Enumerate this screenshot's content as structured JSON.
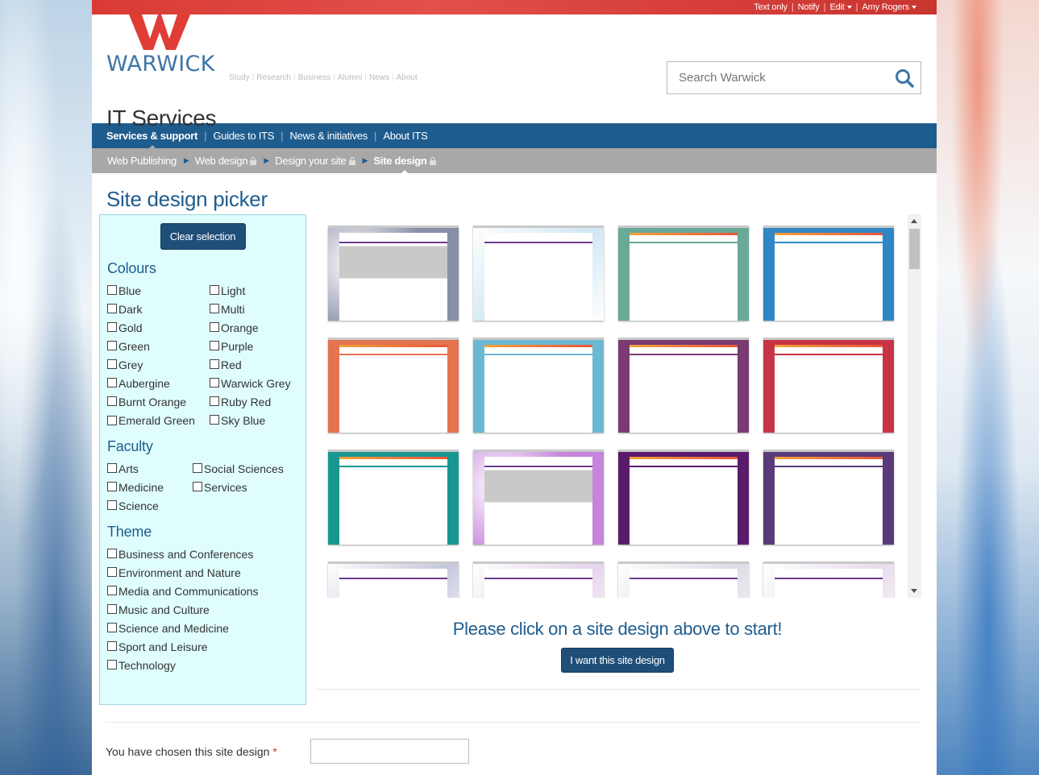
{
  "utility": {
    "text_only": "Text only",
    "notify": "Notify",
    "edit": "Edit",
    "user": "Amy Rogers",
    "separator": "|"
  },
  "logo": {
    "text": "WARWICK"
  },
  "site_links": [
    "Study",
    "Research",
    "Business",
    "Alumni",
    "News",
    "About"
  ],
  "search": {
    "placeholder": "Search Warwick"
  },
  "site_title": "IT Services",
  "nav": [
    "Services & support",
    "Guides to ITS",
    "News & initiatives",
    "About ITS"
  ],
  "breadcrumbs": [
    "Web Publishing",
    "Web design",
    "Design your site",
    "Site design"
  ],
  "page_title": "Site design picker",
  "filters": {
    "clear_label": "Clear selection",
    "colours": {
      "heading": "Colours",
      "col1": [
        "Blue",
        "Dark",
        "Gold",
        "Green",
        "Grey",
        "Aubergine",
        "Burnt Orange",
        "Emerald Green"
      ],
      "col2": [
        "Light",
        "Multi",
        "Orange",
        "Purple",
        "Red",
        "Warwick Grey",
        "Ruby Red",
        "Sky Blue"
      ]
    },
    "faculty": {
      "heading": "Faculty",
      "col1": [
        "Arts",
        "Medicine",
        "Science"
      ],
      "col2": [
        "Social Sciences",
        "Services"
      ]
    },
    "theme": {
      "heading": "Theme",
      "items": [
        "Business and Conferences",
        "Environment and Nature",
        "Media and Communications",
        "Music and Culture",
        "Science and Medicine",
        "Sport and Leisure",
        "Technology"
      ]
    }
  },
  "designs": [
    {
      "side": "#8a8fa8",
      "style": "photo"
    },
    {
      "side": "#cfe6f2",
      "style": "light"
    },
    {
      "side": "#6aa898",
      "style": "plain"
    },
    {
      "side": "#2f86c4",
      "style": "plain"
    },
    {
      "side": "#e5734f",
      "style": "plain"
    },
    {
      "side": "#6ab8d2",
      "style": "plain"
    },
    {
      "side": "#7a3b73",
      "style": "plain"
    },
    {
      "side": "#c73544",
      "style": "plain"
    },
    {
      "side": "#1a9690",
      "style": "plain"
    },
    {
      "side": "#c684dc",
      "style": "photo"
    },
    {
      "side": "#5a1c6a",
      "style": "plain"
    },
    {
      "side": "#5a3a78",
      "style": "plain"
    },
    {
      "side": "#c5c7dc",
      "style": "light"
    },
    {
      "side": "#e6d3ec",
      "style": "light"
    },
    {
      "side": "#dcdce6",
      "style": "light"
    },
    {
      "side": "#e8dcec",
      "style": "light"
    }
  ],
  "prompt": "Please click on a site design above to start!",
  "choose_label": "I want this site design",
  "chosen": {
    "label": "You have chosen this site design",
    "required_mark": "*",
    "value": ""
  }
}
